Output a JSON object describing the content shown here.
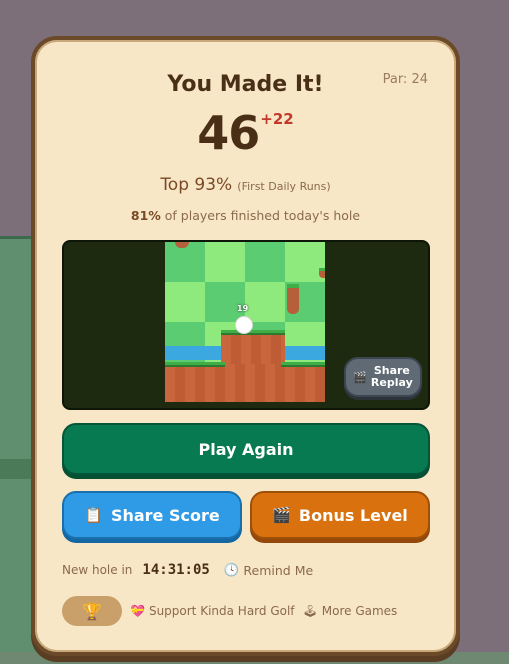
{
  "dialog": {
    "par_label": "Par: 24",
    "title": "You Made It!",
    "score": "46",
    "score_delta": "+22",
    "rank_main": "Top 93%",
    "rank_note": "(First Daily Runs)",
    "finished_pct": "81%",
    "finished_text": " of players finished today's hole"
  },
  "replay": {
    "ball_number": "19",
    "share_label_line1": "Share",
    "share_label_line2": "Replay",
    "share_icon": "clapperboard-icon"
  },
  "buttons": {
    "play_again": "Play Again",
    "share_score": "Share Score",
    "share_score_icon": "clipboard-icon",
    "bonus_level": "Bonus Level",
    "bonus_level_icon": "clapperboard-icon"
  },
  "timer": {
    "label": "New hole in",
    "time": "14:31:05",
    "remind_label": "Remind Me",
    "remind_icon": "clock-icon"
  },
  "footer": {
    "trophy_icon": "trophy-icon",
    "support_label": "Support Kinda Hard Golf",
    "support_icon": "heart-icon",
    "more_games_label": "More Games",
    "more_games_icon": "joystick-icon"
  },
  "colors": {
    "card_bg": "#f8e7c7",
    "play_again": "#087a52",
    "share_score": "#2f9be6",
    "bonus_level": "#d9720e",
    "score_delta": "#c0392b"
  }
}
